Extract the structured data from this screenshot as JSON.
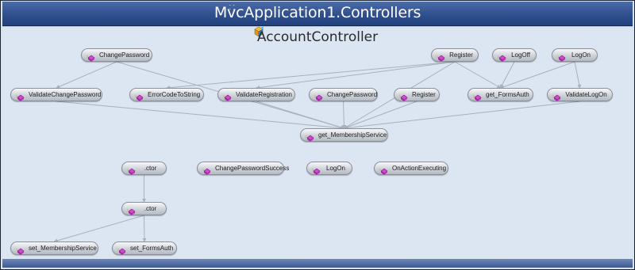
{
  "header": {
    "namespace_title": "MvcApplication1.Controllers"
  },
  "class_box": {
    "title": "AccountController",
    "icon": "class-icon"
  },
  "method_icon": "method-icon",
  "colors": {
    "header": "#2f4f8f",
    "canvas": "#dce6f3",
    "edge": "#a9b0ba",
    "method_icon": "#c23bc2"
  },
  "nodes": [
    {
      "id": "changepassword-top",
      "label": "ChangePassword"
    },
    {
      "id": "register-top",
      "label": "Register"
    },
    {
      "id": "logoff",
      "label": "LogOff"
    },
    {
      "id": "logon-top",
      "label": "LogOn"
    },
    {
      "id": "validatechangepassword",
      "label": "ValidateChangePassword"
    },
    {
      "id": "errorcodetostring",
      "label": "ErrorCodeToString"
    },
    {
      "id": "validateregistration",
      "label": "ValidateRegistration"
    },
    {
      "id": "changepassword-mid",
      "label": "ChangePassword"
    },
    {
      "id": "register-mid",
      "label": "Register"
    },
    {
      "id": "get-formsauth",
      "label": "get_FormsAuth"
    },
    {
      "id": "validatelogon",
      "label": "ValidateLogOn"
    },
    {
      "id": "get-membershipservice",
      "label": "get_MembershipService"
    },
    {
      "id": "ctor-1",
      "label": ".ctor"
    },
    {
      "id": "changepasswordsuccess",
      "label": "ChangePasswordSuccess"
    },
    {
      "id": "logon-low",
      "label": "LogOn"
    },
    {
      "id": "onactionexecuting",
      "label": "OnActionExecuting"
    },
    {
      "id": "ctor-2",
      "label": ".ctor"
    },
    {
      "id": "set-membershipservice",
      "label": "set_MembershipService"
    },
    {
      "id": "set-formsauth",
      "label": "set_FormsAuth"
    }
  ],
  "edges": [
    [
      "changepassword-top",
      "validatechangepassword"
    ],
    [
      "changepassword-top",
      "get-membershipservice"
    ],
    [
      "register-top",
      "errorcodetostring"
    ],
    [
      "register-top",
      "validateregistration"
    ],
    [
      "register-top",
      "get-formsauth"
    ],
    [
      "register-top",
      "get-membershipservice"
    ],
    [
      "logoff",
      "get-formsauth"
    ],
    [
      "logon-top",
      "get-formsauth"
    ],
    [
      "logon-top",
      "validatelogon"
    ],
    [
      "validatechangepassword",
      "get-membershipservice"
    ],
    [
      "validateregistration",
      "get-membershipservice"
    ],
    [
      "changepassword-mid",
      "get-membershipservice"
    ],
    [
      "register-mid",
      "get-membershipservice"
    ],
    [
      "validatelogon",
      "get-membershipservice"
    ],
    [
      "ctor-1",
      "ctor-2"
    ],
    [
      "ctor-2",
      "set-membershipservice"
    ],
    [
      "ctor-2",
      "set-formsauth"
    ]
  ]
}
